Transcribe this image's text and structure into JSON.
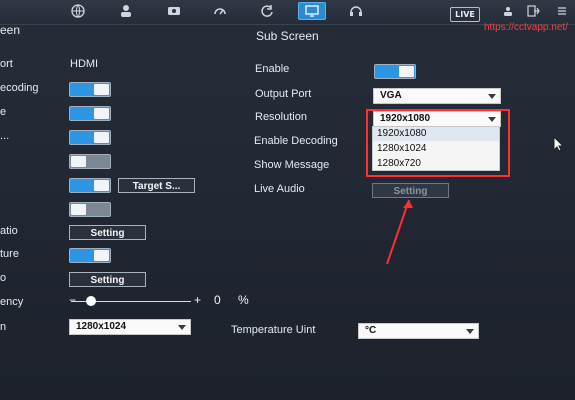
{
  "topbar": {
    "live": "LIVE"
  },
  "watermark": "https://cctvapp.net/",
  "left_panel": {
    "section_title": "een",
    "port_label": "ort",
    "port_value": "HDMI",
    "decoding_label": "ecoding",
    "row3_label": "e",
    "row4_label": "...",
    "target_button": "Target S...",
    "ratio_label": "atio",
    "ratio_button": "Setting",
    "ture_label": "ture",
    "row_o_label": "o",
    "row_o_button": "Setting",
    "ency_label": "ency",
    "slider_minus": "−",
    "slider_plus": "+",
    "slider_value": "0",
    "slider_unit": "%",
    "resolution_label": "n",
    "resolution_value": "1280x1024"
  },
  "right_panel": {
    "title": "Sub Screen",
    "enable_label": "Enable",
    "output_port_label": "Output Port",
    "output_port_value": "VGA",
    "resolution_label": "Resolution",
    "resolution_value": "1920x1080",
    "enable_decoding_label": "Enable Decoding",
    "show_message_label": "Show Message",
    "live_audio_label": "Live Audio",
    "live_audio_button": "Setting",
    "temperature_label": "Temperature Uint",
    "temperature_value": "°C",
    "dropdown_options": [
      "1920x1080",
      "1280x1024",
      "1280x720"
    ]
  }
}
